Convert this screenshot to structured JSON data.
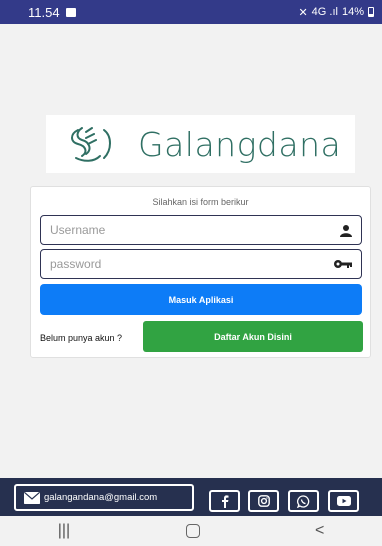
{
  "status_bar": {
    "time": "11.54",
    "signal_text": "4G .ıl",
    "battery": "14%",
    "icons": [
      "message-icon",
      "mute-icon",
      "signal-icon",
      "battery-icon"
    ]
  },
  "logo": {
    "text": "Galangdana",
    "icon": "helping-hands-icon"
  },
  "form": {
    "title": "Silahkan isi form berikur",
    "username_placeholder": "Username",
    "password_placeholder": "password",
    "username_icon": "user-icon",
    "password_icon": "key-icon",
    "login_label": "Masuk Aplikasi",
    "no_account_label": "Belum punya akun ?",
    "register_label": "Daftar Akun Disini"
  },
  "footer": {
    "email": "galangandana@gmail.com",
    "email_icon": "mail-icon",
    "social_icons": [
      "facebook-icon",
      "instagram-icon",
      "whatsapp-icon",
      "youtube-icon"
    ]
  },
  "navbar": {
    "recent": "|||",
    "back": "<"
  },
  "colors": {
    "status_bar": "#333a89",
    "login_button": "#0d7cf7",
    "register_button": "#31a342",
    "footer": "#26304f",
    "logo_text": "#2f6f63"
  }
}
